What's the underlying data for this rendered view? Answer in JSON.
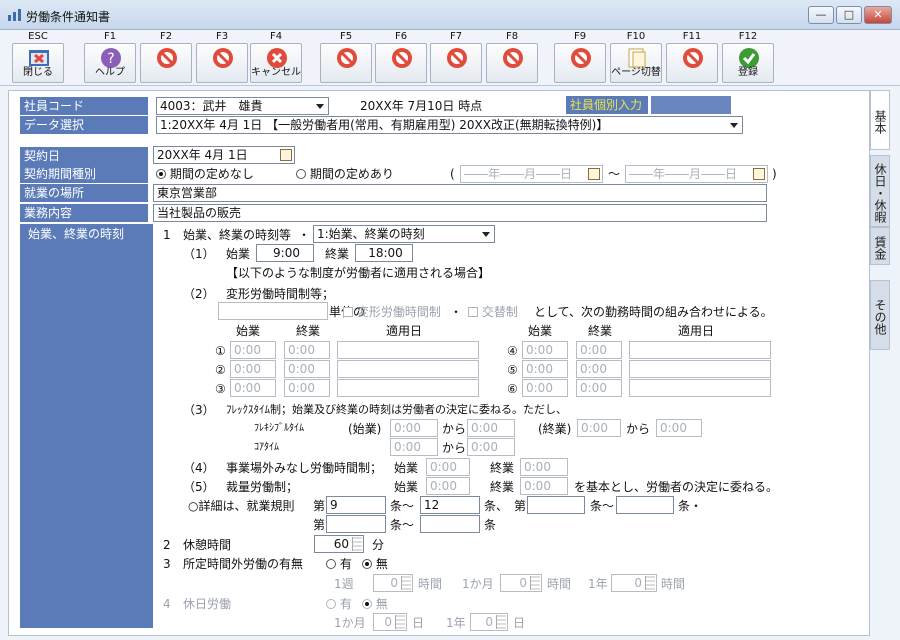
{
  "window": {
    "title": "労働条件通知書",
    "min": "—",
    "max": "□",
    "close": "✕"
  },
  "fkeys": [
    {
      "key": "ESC",
      "label": "閉じる",
      "icon": "close-doc-icon"
    },
    {
      "key": "F1",
      "label": "ヘルプ",
      "icon": "help-icon"
    },
    {
      "key": "F2",
      "label": "",
      "icon": "disabled-icon"
    },
    {
      "key": "F3",
      "label": "",
      "icon": "disabled-icon"
    },
    {
      "key": "F4",
      "label": "キャンセル",
      "icon": "cancel-icon"
    },
    {
      "key": "F5",
      "label": "",
      "icon": "disabled-icon"
    },
    {
      "key": "F6",
      "label": "",
      "icon": "disabled-icon"
    },
    {
      "key": "F7",
      "label": "",
      "icon": "disabled-icon"
    },
    {
      "key": "F8",
      "label": "",
      "icon": "disabled-icon"
    },
    {
      "key": "F9",
      "label": "",
      "icon": "disabled-icon"
    },
    {
      "key": "F10",
      "label": "ページ切替",
      "icon": "page-switch-icon"
    },
    {
      "key": "F11",
      "label": "",
      "icon": "disabled-icon"
    },
    {
      "key": "F12",
      "label": "登録",
      "icon": "register-icon"
    }
  ],
  "tabs": [
    "基本",
    "休日・休暇",
    "賃金",
    "その他"
  ],
  "header": {
    "employee_code_label": "社員コード",
    "employee_code_value": "4003：武井　雄貴",
    "as_of": "20XX年 7月10日 時点",
    "individual_input_label": "社員個別入力",
    "data_select_label": "データ選択",
    "data_select_value": "1:20XX年 4月 1日 【一般労働者用(常用、有期雇用型) 20XX改正(無期転換特例)】"
  },
  "form": {
    "contract_date_label": "契約日",
    "contract_date_value": "20XX年 4月 1日",
    "period_label": "契約期間種別",
    "period_opt1": "期間の定めなし",
    "period_opt2": "期間の定めあり",
    "paren_open": "(",
    "paren_close": ")",
    "tilde": "～",
    "date_placeholder": "――年――月――日",
    "workplace_label": "就業の場所",
    "workplace_value": "東京営業部",
    "job_label": "業務内容",
    "job_value": "当社製品の販売",
    "hours_label": "始業、終業の時刻"
  },
  "hours": {
    "n1": "1",
    "item1": "始業、終業の時刻等",
    "dot": "・",
    "item1_select": "1:始業、終業の時刻",
    "p1": "（1）",
    "start_label": "始業",
    "start_value": "9:00",
    "end_label": "終業",
    "end_value": "18:00",
    "note": "【以下のような制度が労働者に適用される場合】",
    "p2": "（2）",
    "variable_label": "変形労働時間制等；",
    "unit_text": "単位の",
    "cb_variable": "変形労働時間制",
    "cb_shift": "交替制",
    "combo_text": "として、次の勤務時間の組み合わせによる。",
    "col_start": "始業",
    "col_end": "終業",
    "col_date": "適用日",
    "circ": [
      "①",
      "②",
      "③",
      "④",
      "⑤",
      "⑥"
    ],
    "time0": "0:00",
    "p3": "（3）",
    "flex_text": "ﾌﾚｯｸｽﾀｲﾑ制；始業及び終業の時刻は労働者の決定に委ねる。ただし、",
    "flexible": "ﾌﾚｷｼﾌﾞﾙﾀｲﾑ",
    "core": "ｺｱﾀｲﾑ",
    "start_paren": "(始業)",
    "end_paren": "(終業)",
    "from": "から",
    "p4": "（4）",
    "deemed": "事業場外みなし労働時間制；",
    "p5": "（5）",
    "discretion": "裁量労働制；",
    "base_text": "を基本とし、労働者の決定に委ねる。",
    "rules_text": "○詳細は、就業規則",
    "dai": "第",
    "jo_tilde": "条～",
    "jo": "条、",
    "jo_end": "条",
    "jo_dot": "条・",
    "rule1": "9",
    "rule2": "12"
  },
  "rest": {
    "n": "2",
    "label": "休憩時間",
    "value": "60",
    "unit": "分"
  },
  "overtime": {
    "n": "3",
    "label": "所定時間外労働の有無",
    "yes": "有",
    "no": "無",
    "week": "1週",
    "month": "1か月",
    "year": "1年",
    "hour": "時間",
    "value": "0"
  },
  "holiday": {
    "n": "4",
    "label": "休日労働",
    "yes": "有",
    "no": "無",
    "month": "1か月",
    "year": "1年",
    "day": "日",
    "value": "0"
  }
}
